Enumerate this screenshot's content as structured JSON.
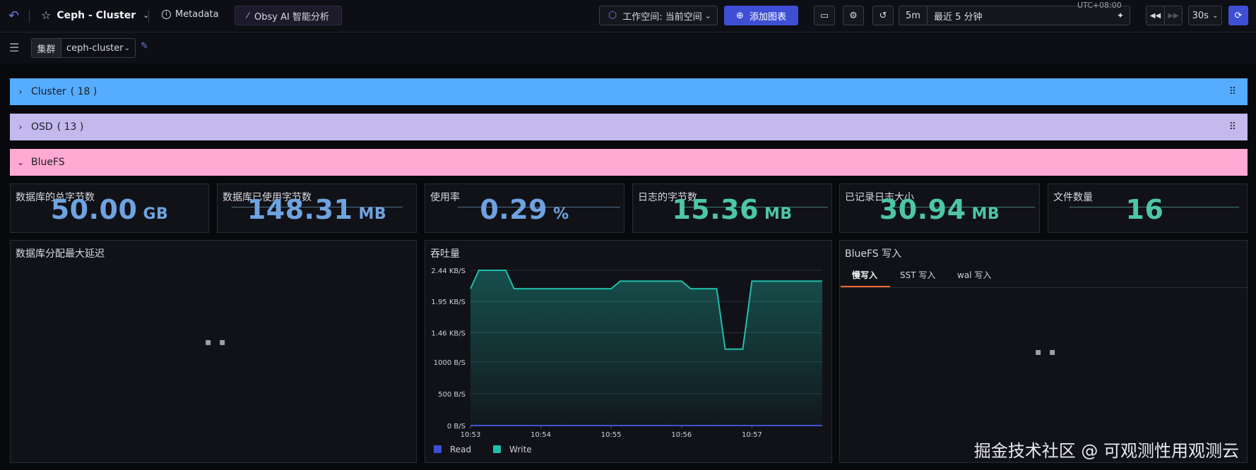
{
  "header": {
    "dashboard_title": "Ceph - Cluster",
    "metadata_label": "Metadata",
    "ai_label": "Obsy AI 智能分析",
    "workspace_label": "工作空间: 当前空间",
    "add_chart_label": "添加图表",
    "time_short": "5m",
    "time_range": "最近 5 分钟",
    "timezone": "UTC+08:00",
    "refresh_interval": "30s"
  },
  "filter": {
    "label": "集群",
    "value": "ceph-cluster"
  },
  "rows": [
    {
      "name": "Cluster",
      "count": "( 18 )",
      "color": "#56acff"
    },
    {
      "name": "OSD",
      "count": "( 13 )",
      "color": "#c4b9ec"
    },
    {
      "name": "BlueFS",
      "count": "",
      "color": "#ffa9d3"
    }
  ],
  "stats": [
    {
      "title": "数据库的总字节数",
      "value": "50.00",
      "unit": "GB",
      "color": "#6ea3e0"
    },
    {
      "title": "数据库已使用字节数",
      "value": "148.31",
      "unit": "MB",
      "color": "#6ea3e0"
    },
    {
      "title": "使用率",
      "value": "0.29",
      "unit": "%",
      "color": "#6ea3e0"
    },
    {
      "title": "日志的字节数",
      "value": "15.36",
      "unit": "MB",
      "color": "#4dc6a6"
    },
    {
      "title": "已记录日志大小",
      "value": "30.94",
      "unit": "MB",
      "color": "#4dc6a6"
    },
    {
      "title": "文件数量",
      "value": "16",
      "unit": "",
      "color": "#4dc6a6"
    }
  ],
  "latency_panel": {
    "title": "数据库分配最大延迟",
    "loading_text": "▪ ▪"
  },
  "bluefs_panel": {
    "title": "BlueFS 写入",
    "tabs": [
      "慢写入",
      "SST 写入",
      "wal 写入"
    ],
    "loading_text": "▪ ▪"
  },
  "chart_data": {
    "type": "area",
    "title": "吞吐量",
    "y_ticks": [
      "0 B/S",
      "500 B/S",
      "1000 B/S",
      "1.46 KB/S",
      "1.95 KB/S",
      "2.44 KB/S"
    ],
    "y_tick_values": [
      0,
      500,
      1000,
      1460,
      1950,
      2440
    ],
    "ylim": [
      0,
      2440
    ],
    "x_ticks": [
      "10:53",
      "10:54",
      "10:55",
      "10:56",
      "10:57"
    ],
    "x_tick_minutes": [
      0,
      1,
      2,
      3,
      4
    ],
    "xlim": [
      0,
      5
    ],
    "series": [
      {
        "name": "Read",
        "color": "#3e4fd6",
        "x": [
          0,
          5
        ],
        "y": [
          0,
          0
        ]
      },
      {
        "name": "Write",
        "color": "#1fbfae",
        "x": [
          0,
          0.12,
          0.5,
          0.62,
          2,
          2.13,
          3,
          3.13,
          3.5,
          3.62,
          3.87,
          4,
          5
        ],
        "y": [
          2150,
          2440,
          2440,
          2150,
          2150,
          2270,
          2270,
          2150,
          2150,
          1200,
          1200,
          2270,
          2270
        ]
      }
    ]
  },
  "watermark": "掘金技术社区 @ 可观测性用观测云"
}
